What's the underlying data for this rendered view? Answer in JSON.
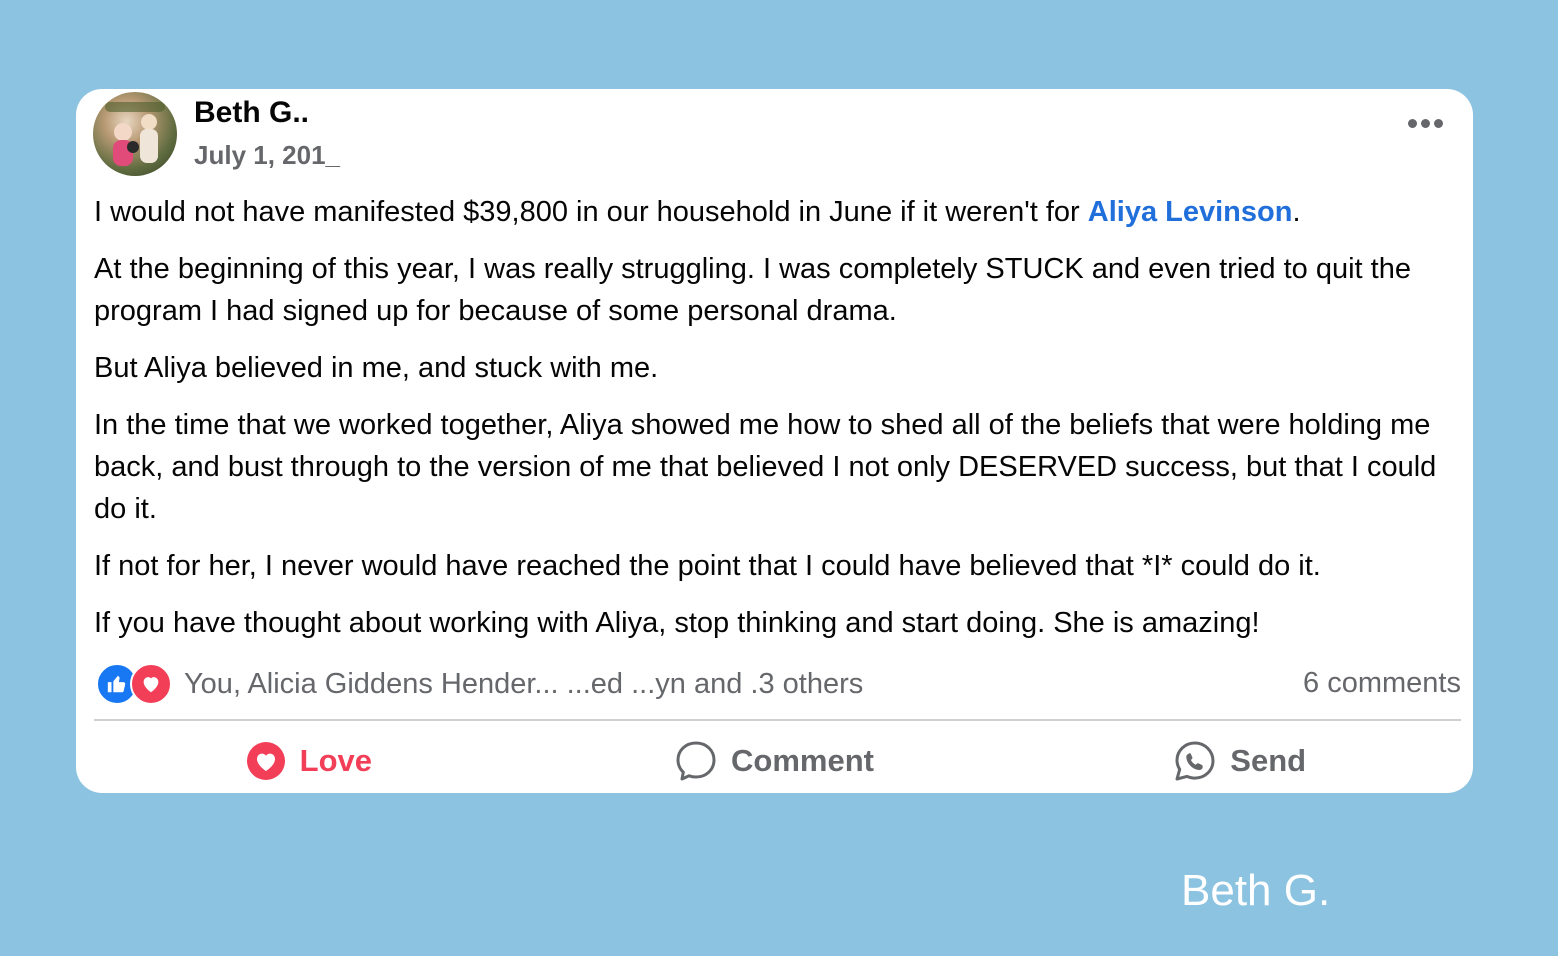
{
  "post": {
    "author": "Beth G..",
    "date": "July 1, 201_",
    "paragraphs": {
      "p1_before": "I would not have manifested $39,800 in our household in June if it weren't for ",
      "p1_mention": "Aliya Levinson",
      "p1_after": ".",
      "p2": "At the beginning of this year, I was really struggling. I was completely STUCK and even tried to quit the program I had signed up for because of some personal drama.",
      "p3": "But Aliya believed in me, and stuck with me.",
      "p4": "In the time that we worked together, Aliya showed me how to shed all of the beliefs that were holding me back, and bust through to the version of me that believed I not only DESERVED success, but that I could do it.",
      "p5": "If not for her, I never would have reached the point that I could have believed that *I* could do it.",
      "p6": "If you have thought about working with Aliya, stop thinking and start doing. She is amazing!"
    },
    "reactions_text": "You, Alicia Giddens Hender... ...ed ...yn and .3 others",
    "comments_count": "6 comments",
    "actions": {
      "love": "Love",
      "comment": "Comment",
      "send": "Send"
    },
    "icons": {
      "more": "more-options-icon",
      "like_reaction": "thumbs-up-icon",
      "love_reaction": "heart-icon",
      "love_action": "heart-icon",
      "comment_action": "speech-bubble-icon",
      "send_action": "messenger-icon"
    }
  },
  "watermark": "Beth G.",
  "colors": {
    "background": "#8cc3e1",
    "mention": "#216fdb",
    "love": "#f33e58",
    "like": "#1877f2",
    "muted": "#65676b"
  }
}
